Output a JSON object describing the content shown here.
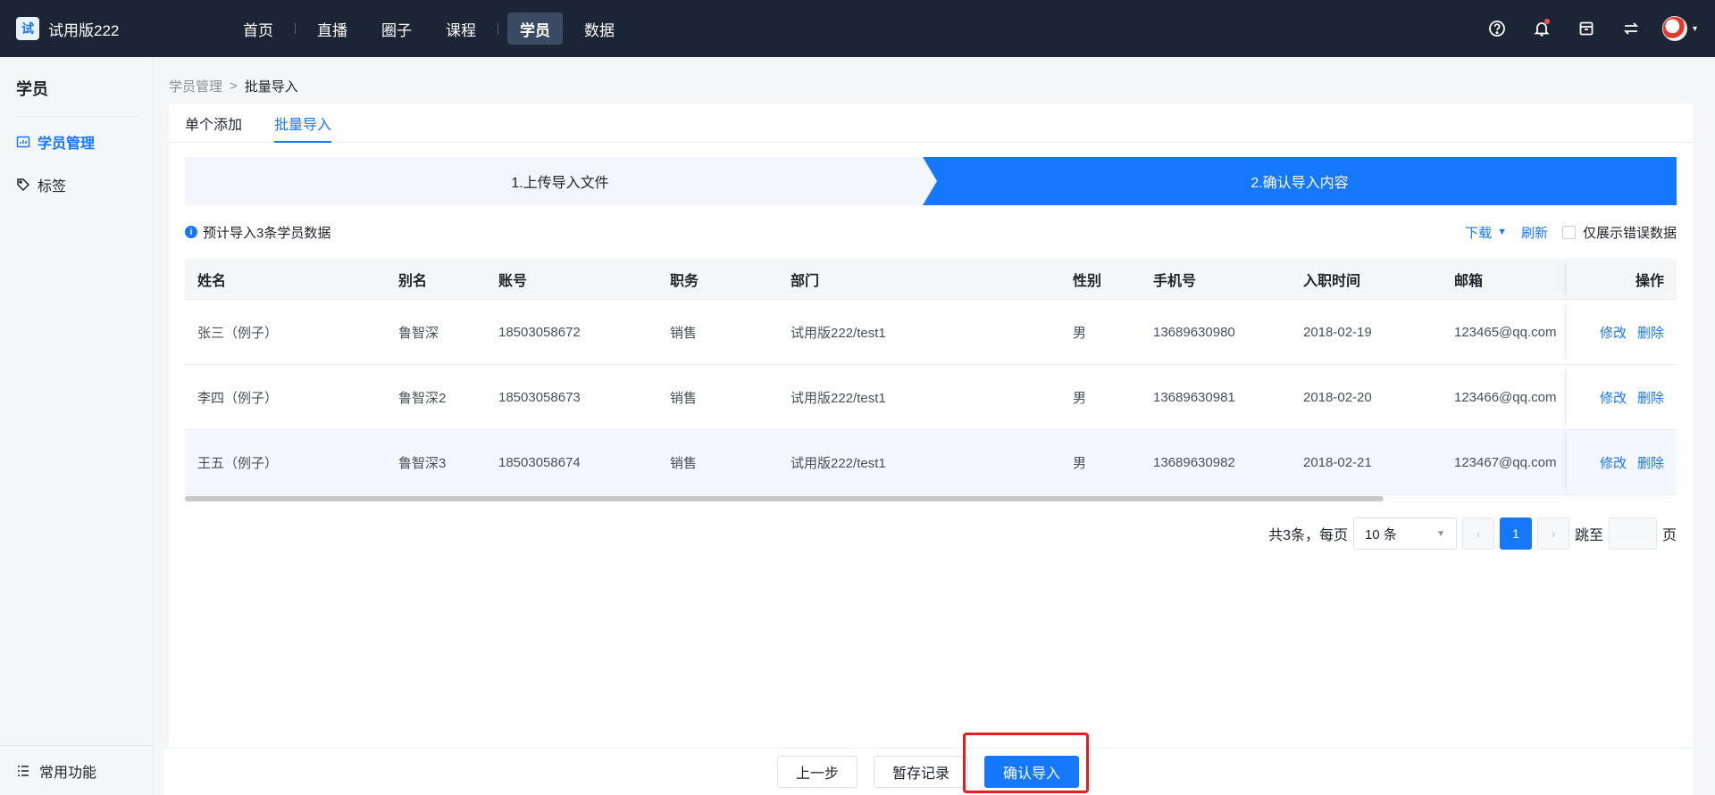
{
  "app": {
    "title": "试用版222",
    "logo_text": "试"
  },
  "nav": [
    "首页",
    "直播",
    "圈子",
    "课程",
    "学员",
    "数据"
  ],
  "sidebar": {
    "title": "学员",
    "items": [
      {
        "label": "学员管理",
        "icon": "chart-icon"
      },
      {
        "label": "标签",
        "icon": "tag-icon"
      }
    ],
    "bottom": "常用功能"
  },
  "breadcrumb": {
    "parent": "学员管理",
    "sep": ">",
    "current": "批量导入"
  },
  "tabs": [
    "单个添加",
    "批量导入"
  ],
  "steps": [
    "1.上传导入文件",
    "2.确认导入内容"
  ],
  "info": {
    "text": "预计导入3条学员数据",
    "icon": "i"
  },
  "tools": {
    "download": "下载",
    "refresh": "刷新",
    "only_errors": "仅展示错误数据"
  },
  "table": {
    "headers": [
      "姓名",
      "别名",
      "账号",
      "职务",
      "部门",
      "性别",
      "手机号",
      "入职时间",
      "邮箱",
      "操作"
    ],
    "rows": [
      [
        "张三（例子）",
        "鲁智深",
        "18503058672",
        "销售",
        "试用版222/test1",
        "男",
        "13689630980",
        "2018-02-19",
        "123465@qq.com"
      ],
      [
        "李四（例子）",
        "鲁智深2",
        "18503058673",
        "销售",
        "试用版222/test1",
        "男",
        "13689630981",
        "2018-02-20",
        "123466@qq.com"
      ],
      [
        "王五（例子）",
        "鲁智深3",
        "18503058674",
        "销售",
        "试用版222/test1",
        "男",
        "13689630982",
        "2018-02-21",
        "123467@qq.com"
      ]
    ],
    "ops": {
      "edit": "修改",
      "delete": "删除"
    }
  },
  "pager": {
    "total": "共3条，每页",
    "size": "10 条",
    "current": "1",
    "jump": "跳至",
    "page": "页",
    "prev": "‹",
    "next": "›"
  },
  "footer": {
    "prev": "上一步",
    "save": "暂存记录",
    "confirm": "确认导入"
  },
  "colors": {
    "accent": "#1677ff",
    "topbar": "#1c2535",
    "highlight": "#e81c1c"
  }
}
